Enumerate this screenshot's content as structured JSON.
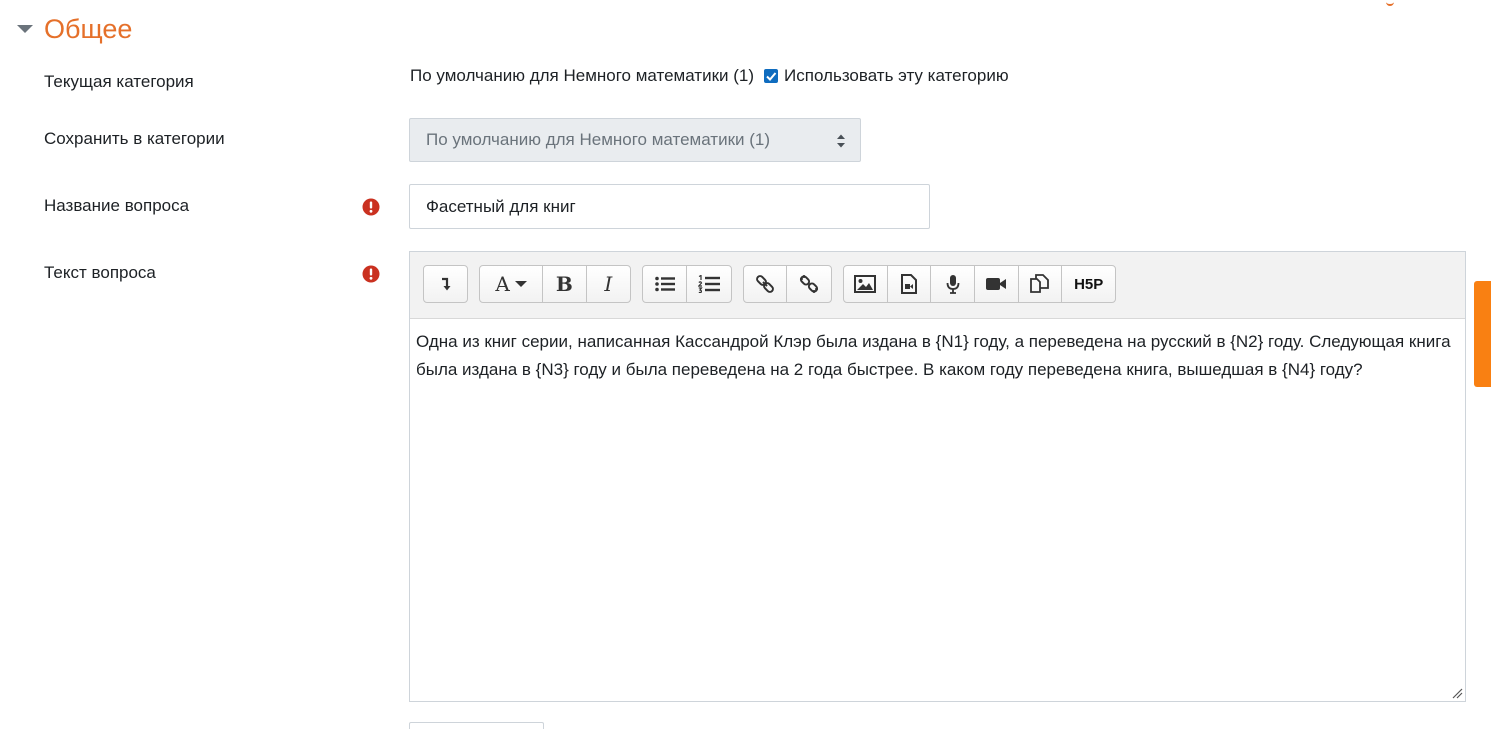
{
  "section": {
    "title": "Общее"
  },
  "fields": {
    "current_category": {
      "label": "Текущая категория",
      "value": "По умолчанию для Немного математики (1)",
      "checkbox_label": "Использовать эту категорию",
      "checkbox_checked": true
    },
    "save_in_category": {
      "label": "Сохранить в категории",
      "selected": "По умолчанию для Немного математики (1)"
    },
    "question_name": {
      "label": "Название вопроса",
      "value": "Фасетный для книг",
      "required": true
    },
    "question_text": {
      "label": "Текст вопроса",
      "required": true,
      "content": "Одна из книг серии, написанная Кассандрой Клэр была издана в {N1} году, а переведена на русский в {N2} году. Следующая книга была издана в {N3} году и была переведена на 2 года быстрее. В каком году переведена книга, вышедшая в {N4} году?"
    }
  },
  "toolbar": {
    "groups": [
      [
        "toolbar-toggle-icon"
      ],
      [
        "font-style-icon",
        "bold-icon",
        "italic-icon"
      ],
      [
        "unordered-list-icon",
        "ordered-list-icon"
      ],
      [
        "link-icon",
        "unlink-icon"
      ],
      [
        "image-icon",
        "media-icon",
        "record-audio-icon",
        "record-video-icon",
        "manage-files-icon",
        "h5p-icon"
      ]
    ],
    "bold_glyph": "B",
    "italic_glyph": "I",
    "font_glyph": "A",
    "h5p_label": "H5P"
  },
  "colors": {
    "accent": "#e5702a",
    "checkbox": "#0f6cbf",
    "required": "#ca3120",
    "side_tab": "#f98012"
  }
}
